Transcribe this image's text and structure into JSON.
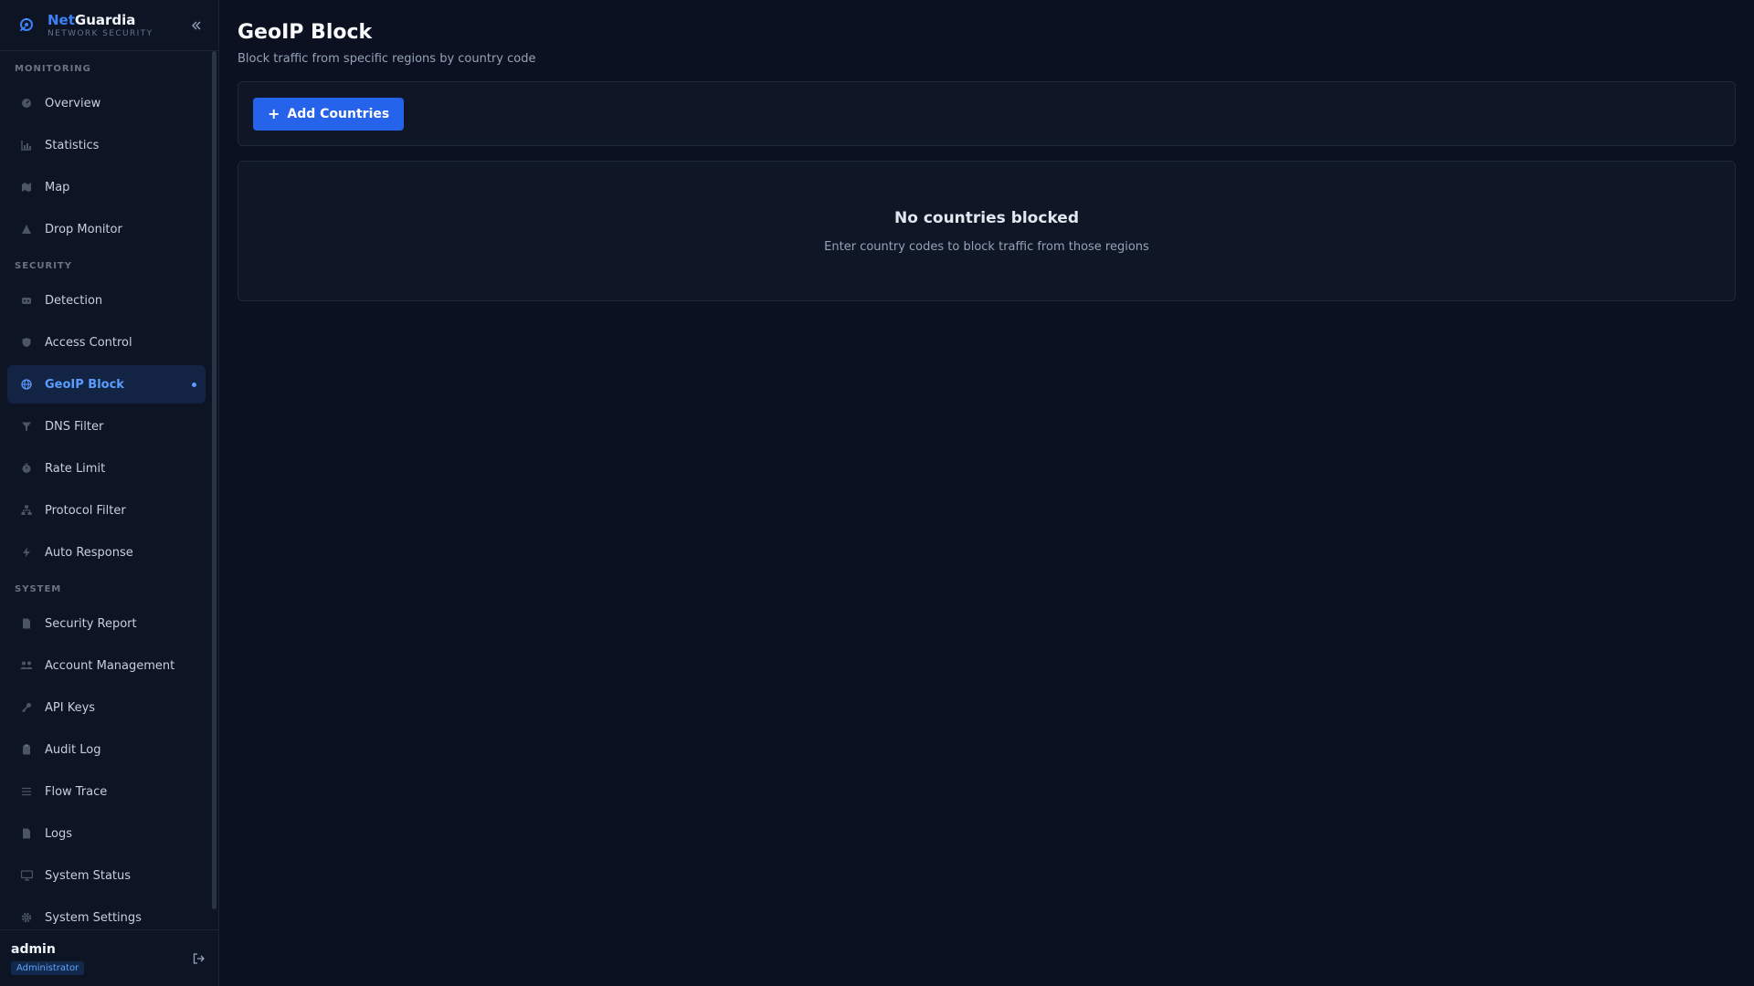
{
  "brand": {
    "name_part1": "Net",
    "name_part2": "Guardia",
    "subtitle": "NETWORK SECURITY"
  },
  "sidebar": {
    "sections": [
      {
        "label": "MONITORING",
        "items": [
          {
            "label": "Overview",
            "icon": "gauge-icon"
          },
          {
            "label": "Statistics",
            "icon": "bar-chart-icon"
          },
          {
            "label": "Map",
            "icon": "map-icon"
          },
          {
            "label": "Drop Monitor",
            "icon": "warning-icon"
          }
        ]
      },
      {
        "label": "SECURITY",
        "items": [
          {
            "label": "Detection",
            "icon": "radar-icon"
          },
          {
            "label": "Access Control",
            "icon": "shield-icon"
          },
          {
            "label": "GeoIP Block",
            "icon": "globe-icon",
            "active": true
          },
          {
            "label": "DNS Filter",
            "icon": "filter-icon"
          },
          {
            "label": "Rate Limit",
            "icon": "stopwatch-icon"
          },
          {
            "label": "Protocol Filter",
            "icon": "sitemap-icon"
          },
          {
            "label": "Auto Response",
            "icon": "lightning-icon"
          }
        ]
      },
      {
        "label": "SYSTEM",
        "items": [
          {
            "label": "Security Report",
            "icon": "document-icon"
          },
          {
            "label": "Account Management",
            "icon": "users-icon"
          },
          {
            "label": "API Keys",
            "icon": "key-icon"
          },
          {
            "label": "Audit Log",
            "icon": "clipboard-icon"
          },
          {
            "label": "Flow Trace",
            "icon": "list-icon"
          },
          {
            "label": "Logs",
            "icon": "file-icon"
          },
          {
            "label": "System Status",
            "icon": "monitor-icon"
          },
          {
            "label": "System Settings",
            "icon": "gear-icon"
          }
        ]
      }
    ]
  },
  "user": {
    "name": "admin",
    "role": "Administrator"
  },
  "page": {
    "title": "GeoIP Block",
    "subtitle": "Block traffic from specific regions by country code"
  },
  "toolbar": {
    "add_label": "Add Countries"
  },
  "empty_state": {
    "title": "No countries blocked",
    "description": "Enter country codes to block traffic from those regions"
  },
  "colors": {
    "accent": "#2563eb",
    "active_text": "#5b9cff",
    "background": "#0b1120"
  }
}
